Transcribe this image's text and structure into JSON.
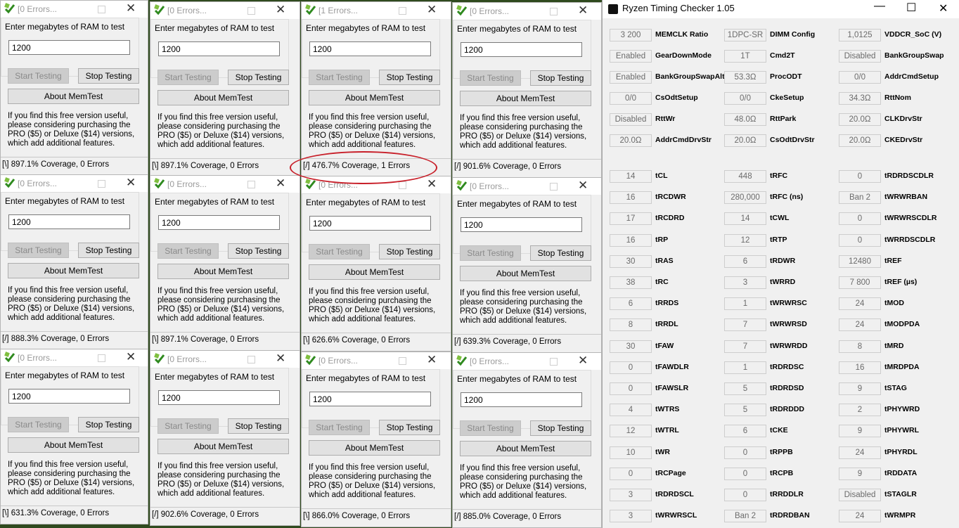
{
  "memtest": {
    "prompt": "Enter megabytes of RAM to test",
    "start_label": "Start Testing",
    "stop_label": "Stop Testing",
    "about_label": "About MemTest",
    "info_text": "If you find this free version useful, please considering purchasing the PRO ($5) or Deluxe ($14) versions, which add additional features.",
    "windows": [
      {
        "title": "[0 Errors...",
        "value": "1200",
        "status": "[\\]   897.1% Coverage, 0 Errors"
      },
      {
        "title": "[0 Errors...",
        "value": "1200",
        "status": "[\\]   897.1% Coverage, 0 Errors"
      },
      {
        "title": "[1 Errors...",
        "value": "1200",
        "status": "[/]   476.7% Coverage, 1 Errors"
      },
      {
        "title": "[0 Errors...",
        "value": "1200",
        "status": "[/]   901.6% Coverage, 0 Errors"
      },
      {
        "title": "[0 Errors...",
        "value": "1200",
        "status": "[/]   888.3% Coverage, 0 Errors"
      },
      {
        "title": "[0 Errors...",
        "value": "1200",
        "status": "[\\]   897.1% Coverage, 0 Errors"
      },
      {
        "title": "[0 Errors...",
        "value": "1200",
        "status": "[\\]   626.6% Coverage, 0 Errors"
      },
      {
        "title": "[0 Errors...",
        "value": "1200",
        "status": "[/]   639.3% Coverage, 0 Errors"
      },
      {
        "title": "[0 Errors...",
        "value": "1200",
        "status": "[\\]   631.3% Coverage, 0 Errors"
      },
      {
        "title": "[0 Errors...",
        "value": "1200",
        "status": "[/]   902.6% Coverage, 0 Errors"
      },
      {
        "title": "[0 Errors...",
        "value": "1200",
        "status": "[\\]   866.0% Coverage, 0 Errors"
      },
      {
        "title": "[0 Errors...",
        "value": "1200",
        "status": "[/]   885.0% Coverage, 0 Errors"
      }
    ]
  },
  "rtc": {
    "title": "Ryzen Timing Checker 1.05",
    "minimize": "—",
    "maximize": "☐",
    "close": "✕",
    "top_rows": [
      [
        {
          "v": "3 200",
          "n": "MEMCLK Ratio"
        },
        {
          "v": "1DPC-SR",
          "n": "DIMM Config"
        },
        {
          "v": "1,0125",
          "n": "VDDCR_SoC (V)"
        }
      ],
      [
        {
          "v": "Enabled",
          "n": "GearDownMode"
        },
        {
          "v": "1T",
          "n": "Cmd2T"
        },
        {
          "v": "Disabled",
          "n": "BankGroupSwap"
        }
      ],
      [
        {
          "v": "Enabled",
          "n": "BankGroupSwapAlt"
        },
        {
          "v": "53.3Ω",
          "n": "ProcODT"
        },
        {
          "v": "0/0",
          "n": "AddrCmdSetup"
        }
      ],
      [
        {
          "v": "0/0",
          "n": "CsOdtSetup"
        },
        {
          "v": "0/0",
          "n": "CkeSetup"
        },
        {
          "v": "34.3Ω",
          "n": "RttNom"
        }
      ],
      [
        {
          "v": "Disabled",
          "n": "RttWr"
        },
        {
          "v": "48.0Ω",
          "n": "RttPark"
        },
        {
          "v": "20.0Ω",
          "n": "CLKDrvStr"
        }
      ],
      [
        {
          "v": "20.0Ω",
          "n": "AddrCmdDrvStr"
        },
        {
          "v": "20.0Ω",
          "n": "CsOdtDrvStr"
        },
        {
          "v": "20.0Ω",
          "n": "CKEDrvStr"
        }
      ]
    ],
    "timing_rows": [
      [
        {
          "v": "14",
          "n": "tCL"
        },
        {
          "v": "448",
          "n": "tRFC"
        },
        {
          "v": "0",
          "n": "tRDRDSCDLR"
        }
      ],
      [
        {
          "v": "16",
          "n": "tRCDWR"
        },
        {
          "v": "280,000",
          "n": "tRFC (ns)"
        },
        {
          "v": "Ban 2",
          "n": "tWRWRBAN"
        }
      ],
      [
        {
          "v": "17",
          "n": "tRCDRD"
        },
        {
          "v": "14",
          "n": "tCWL"
        },
        {
          "v": "0",
          "n": "tWRWRSCDLR"
        }
      ],
      [
        {
          "v": "16",
          "n": "tRP"
        },
        {
          "v": "12",
          "n": "tRTP"
        },
        {
          "v": "0",
          "n": "tWRRDSCDLR"
        }
      ],
      [
        {
          "v": "30",
          "n": "tRAS"
        },
        {
          "v": "6",
          "n": "tRDWR"
        },
        {
          "v": "12480",
          "n": "tREF"
        }
      ],
      [
        {
          "v": "38",
          "n": "tRC"
        },
        {
          "v": "3",
          "n": "tWRRD"
        },
        {
          "v": "7 800",
          "n": "tREF (µs)"
        }
      ],
      [
        {
          "v": "6",
          "n": "tRRDS"
        },
        {
          "v": "1",
          "n": "tWRWRSC"
        },
        {
          "v": "24",
          "n": "tMOD"
        }
      ],
      [
        {
          "v": "8",
          "n": "tRRDL"
        },
        {
          "v": "7",
          "n": "tWRWRSD"
        },
        {
          "v": "24",
          "n": "tMODPDA"
        }
      ],
      [
        {
          "v": "30",
          "n": "tFAW"
        },
        {
          "v": "7",
          "n": "tWRWRDD"
        },
        {
          "v": "8",
          "n": "tMRD"
        }
      ],
      [
        {
          "v": "0",
          "n": "tFAWDLR"
        },
        {
          "v": "1",
          "n": "tRDRDSC"
        },
        {
          "v": "16",
          "n": "tMRDPDA"
        }
      ],
      [
        {
          "v": "0",
          "n": "tFAWSLR"
        },
        {
          "v": "5",
          "n": "tRDRDSD"
        },
        {
          "v": "9",
          "n": "tSTAG"
        }
      ],
      [
        {
          "v": "4",
          "n": "tWTRS"
        },
        {
          "v": "5",
          "n": "tRDRDDD"
        },
        {
          "v": "2",
          "n": "tPHYWRD"
        }
      ],
      [
        {
          "v": "12",
          "n": "tWTRL"
        },
        {
          "v": "6",
          "n": "tCKE"
        },
        {
          "v": "9",
          "n": "tPHYWRL"
        }
      ],
      [
        {
          "v": "10",
          "n": "tWR"
        },
        {
          "v": "0",
          "n": "tRPPB"
        },
        {
          "v": "24",
          "n": "tPHYRDL"
        }
      ],
      [
        {
          "v": "0",
          "n": "tRCPage"
        },
        {
          "v": "0",
          "n": "tRCPB"
        },
        {
          "v": "9",
          "n": "tRDDATA"
        }
      ],
      [
        {
          "v": "3",
          "n": "tRDRDSCL"
        },
        {
          "v": "0",
          "n": "tRRDDLR"
        },
        {
          "v": "Disabled",
          "n": "tSTAGLR"
        }
      ],
      [
        {
          "v": "3",
          "n": "tWRWRSCL"
        },
        {
          "v": "Ban 2",
          "n": "tRDRDBAN"
        },
        {
          "v": "24",
          "n": "tWRMPR"
        }
      ]
    ]
  }
}
